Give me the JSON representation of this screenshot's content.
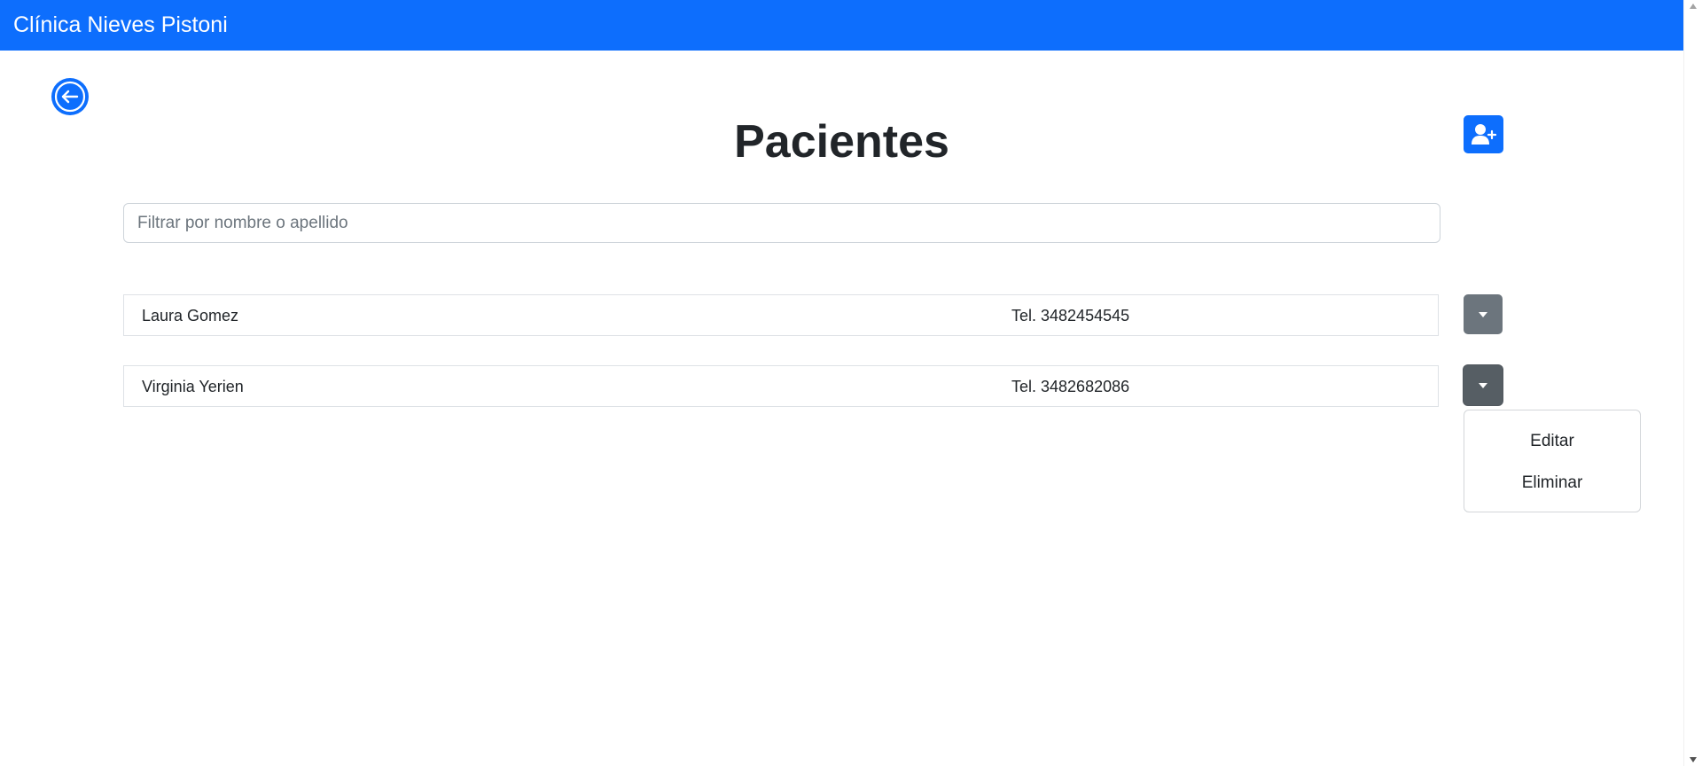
{
  "navbar": {
    "brand": "Clínica Nieves Pistoni",
    "color": "#0d6efd"
  },
  "icons": {
    "back": "arrow-left-circle-icon",
    "add_patient": "person-plus-icon",
    "dropdown": "caret-down-icon"
  },
  "page": {
    "title": "Pacientes"
  },
  "search": {
    "placeholder": "Filtrar por nombre o apellido",
    "value": ""
  },
  "patients": [
    {
      "name": "Laura Gomez",
      "phone": "Tel. 3482454545"
    },
    {
      "name": "Virginia Yerien",
      "phone": "Tel. 3482682086"
    }
  ],
  "dropdown_menu": {
    "items": [
      {
        "label": "Editar"
      },
      {
        "label": "Eliminar"
      }
    ]
  },
  "colors": {
    "primary": "#0d6efd",
    "secondary": "#6c757d",
    "secondary_active": "#565e64"
  }
}
